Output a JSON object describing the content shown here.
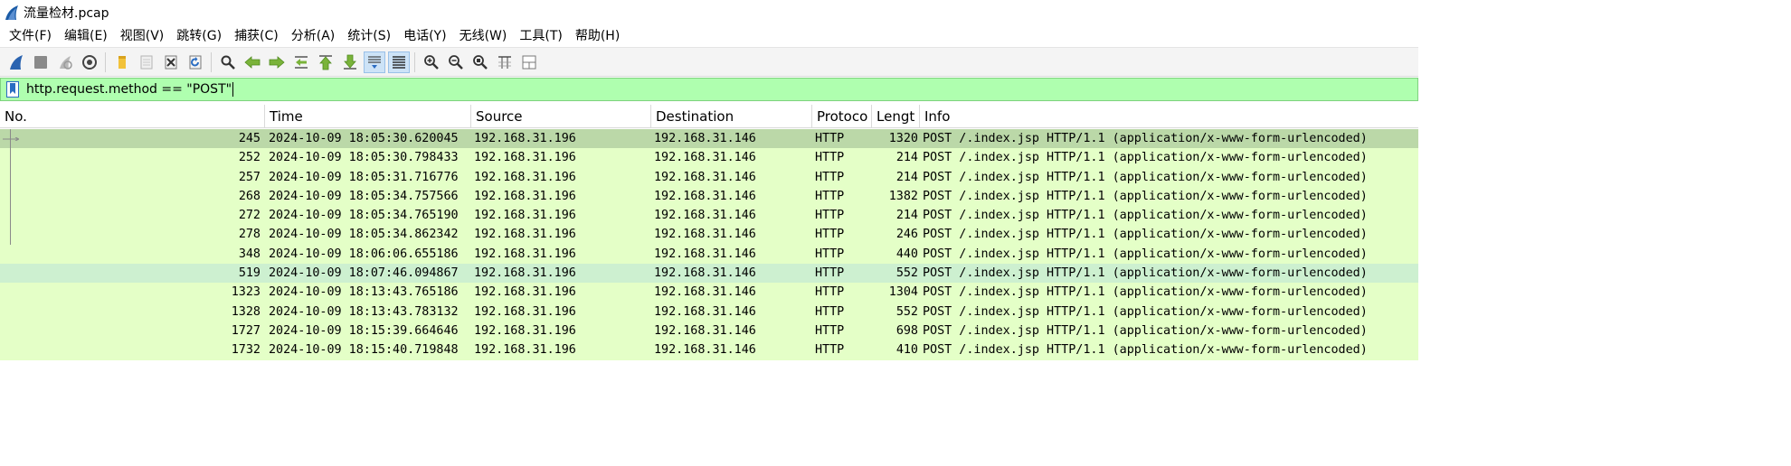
{
  "window": {
    "title": "流量检材.pcap"
  },
  "menu": [
    "文件(F)",
    "编辑(E)",
    "视图(V)",
    "跳转(G)",
    "捕获(C)",
    "分析(A)",
    "统计(S)",
    "电话(Y)",
    "无线(W)",
    "工具(T)",
    "帮助(H)"
  ],
  "toolbar": {
    "icons": [
      "start-capture-icon",
      "stop-capture-icon",
      "restart-capture-icon",
      "capture-options-icon",
      "open-file-icon",
      "save-file-icon",
      "close-file-icon",
      "reload-file-icon",
      "find-packet-icon",
      "go-back-icon",
      "go-forward-icon",
      "go-to-packet-icon",
      "first-packet-icon",
      "last-packet-icon",
      "auto-scroll-icon",
      "colorize-icon",
      "zoom-in-icon",
      "zoom-out-icon",
      "normal-size-icon",
      "resize-columns-icon",
      "layout-icon"
    ]
  },
  "filter": {
    "value": "http.request.method == \"POST\""
  },
  "columns": {
    "no": "No.",
    "time": "Time",
    "source": "Source",
    "destination": "Destination",
    "protocol": "Protoco",
    "length": "Lengt",
    "info": "Info"
  },
  "rows": [
    {
      "no": "245",
      "time": "2024-10-09 18:05:30.620045",
      "source": "192.168.31.196",
      "destination": "192.168.31.146",
      "protocol": "HTTP",
      "length": "1320",
      "info": "POST /.index.jsp HTTP/1.1  (application/x-www-form-urlencoded)"
    },
    {
      "no": "252",
      "time": "2024-10-09 18:05:30.798433",
      "source": "192.168.31.196",
      "destination": "192.168.31.146",
      "protocol": "HTTP",
      "length": "214",
      "info": "POST /.index.jsp HTTP/1.1  (application/x-www-form-urlencoded)"
    },
    {
      "no": "257",
      "time": "2024-10-09 18:05:31.716776",
      "source": "192.168.31.196",
      "destination": "192.168.31.146",
      "protocol": "HTTP",
      "length": "214",
      "info": "POST /.index.jsp HTTP/1.1  (application/x-www-form-urlencoded)"
    },
    {
      "no": "268",
      "time": "2024-10-09 18:05:34.757566",
      "source": "192.168.31.196",
      "destination": "192.168.31.146",
      "protocol": "HTTP",
      "length": "1382",
      "info": "POST /.index.jsp HTTP/1.1  (application/x-www-form-urlencoded)"
    },
    {
      "no": "272",
      "time": "2024-10-09 18:05:34.765190",
      "source": "192.168.31.196",
      "destination": "192.168.31.146",
      "protocol": "HTTP",
      "length": "214",
      "info": "POST /.index.jsp HTTP/1.1  (application/x-www-form-urlencoded)"
    },
    {
      "no": "278",
      "time": "2024-10-09 18:05:34.862342",
      "source": "192.168.31.196",
      "destination": "192.168.31.146",
      "protocol": "HTTP",
      "length": "246",
      "info": "POST /.index.jsp HTTP/1.1  (application/x-www-form-urlencoded)"
    },
    {
      "no": "348",
      "time": "2024-10-09 18:06:06.655186",
      "source": "192.168.31.196",
      "destination": "192.168.31.146",
      "protocol": "HTTP",
      "length": "440",
      "info": "POST /.index.jsp HTTP/1.1  (application/x-www-form-urlencoded)"
    },
    {
      "no": "519",
      "time": "2024-10-09 18:07:46.094867",
      "source": "192.168.31.196",
      "destination": "192.168.31.146",
      "protocol": "HTTP",
      "length": "552",
      "info": "POST /.index.jsp HTTP/1.1  (application/x-www-form-urlencoded)"
    },
    {
      "no": "1323",
      "time": "2024-10-09 18:13:43.765186",
      "source": "192.168.31.196",
      "destination": "192.168.31.146",
      "protocol": "HTTP",
      "length": "1304",
      "info": "POST /.index.jsp HTTP/1.1  (application/x-www-form-urlencoded)"
    },
    {
      "no": "1328",
      "time": "2024-10-09 18:13:43.783132",
      "source": "192.168.31.196",
      "destination": "192.168.31.146",
      "protocol": "HTTP",
      "length": "552",
      "info": "POST /.index.jsp HTTP/1.1  (application/x-www-form-urlencoded)"
    },
    {
      "no": "1727",
      "time": "2024-10-09 18:15:39.664646",
      "source": "192.168.31.196",
      "destination": "192.168.31.146",
      "protocol": "HTTP",
      "length": "698",
      "info": "POST /.index.jsp HTTP/1.1  (application/x-www-form-urlencoded)"
    },
    {
      "no": "1732",
      "time": "2024-10-09 18:15:40.719848",
      "source": "192.168.31.196",
      "destination": "192.168.31.146",
      "protocol": "HTTP",
      "length": "410",
      "info": "POST /.index.jsp HTTP/1.1  (application/x-www-form-urlencoded)"
    }
  ],
  "colors": {
    "row_bg": "#e4ffc7",
    "selected_row_bg": "#bbd8a8",
    "highlight_row_bg": "#cdf0d0",
    "filter_bg": "#afffaf",
    "accent": "#1a5ba6"
  }
}
